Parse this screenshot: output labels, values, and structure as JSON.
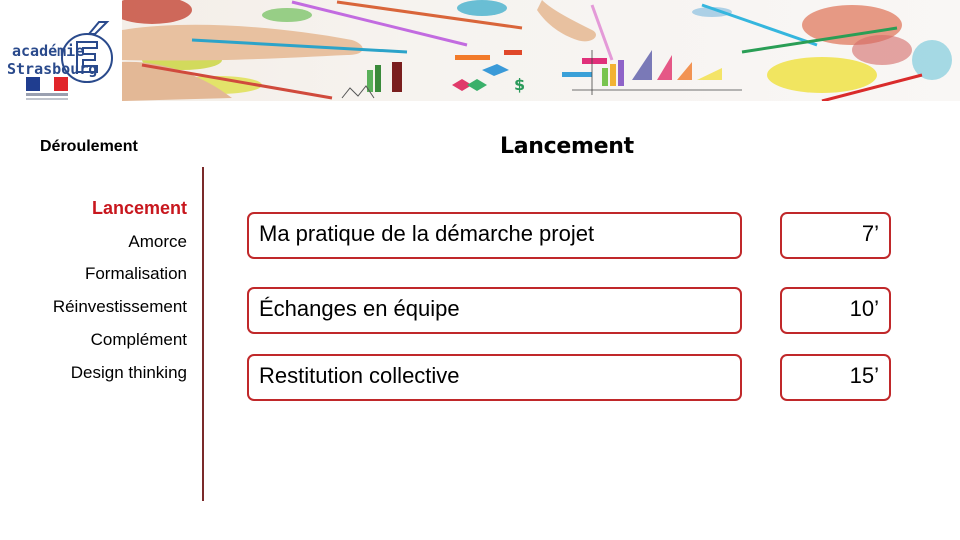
{
  "logo": {
    "line1": "académie",
    "line2": "Strasbourg",
    "emblem": "accent-e-icon",
    "flag_colors": [
      "#1f3d8f",
      "#ffffff",
      "#e1252a"
    ]
  },
  "banner": {
    "description": "hands-with-colored-pencils-drawing-charts-and-paint-splashes"
  },
  "sidebar": {
    "heading": "Déroulement",
    "accent_color": "#c8171e",
    "items": [
      {
        "label": "Lancement",
        "active": true
      },
      {
        "label": "Amorce",
        "active": false
      },
      {
        "label": "Formalisation",
        "active": false
      },
      {
        "label": "Réinvestissement",
        "active": false
      },
      {
        "label": "Complément",
        "active": false
      },
      {
        "label": "Design thinking",
        "active": false
      }
    ]
  },
  "main": {
    "title": "Lancement",
    "border_color": "#c0282a",
    "steps": [
      {
        "label": "Ma pratique de la démarche projet",
        "duration": "7’"
      },
      {
        "label": "Échanges en équipe",
        "duration": "10’"
      },
      {
        "label": "Restitution collective",
        "duration": "15’"
      }
    ]
  }
}
